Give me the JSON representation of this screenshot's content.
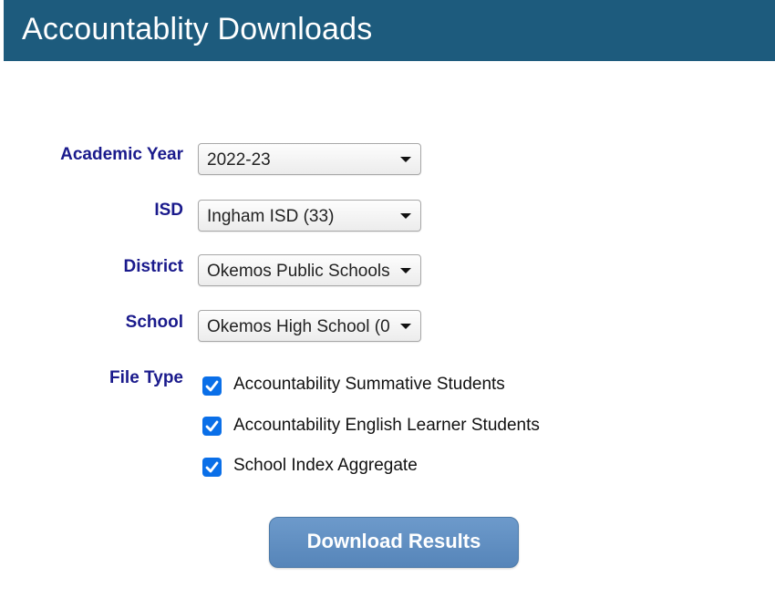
{
  "header": {
    "title": "Accountablity Downloads"
  },
  "form": {
    "academic_year": {
      "label": "Academic Year",
      "value": "2022-23"
    },
    "isd": {
      "label": "ISD",
      "value": "Ingham ISD (33)"
    },
    "district": {
      "label": "District",
      "value": "Okemos Public Schools"
    },
    "school": {
      "label": "School",
      "value": "Okemos High School (0"
    },
    "file_type": {
      "label": "File Type",
      "options": [
        {
          "label": "Accountability Summative Students",
          "checked": true
        },
        {
          "label": "Accountability English Learner Students",
          "checked": true
        },
        {
          "label": "School Index Aggregate",
          "checked": true
        }
      ]
    }
  },
  "download_button": {
    "label": "Download Results"
  },
  "colors": {
    "header_bg": "#1d5b7d",
    "label_text": "#1a1a8c",
    "checkbox_accent": "#0a6fe8",
    "button_bg": "#5f8fc2"
  },
  "icons": {
    "select_arrow": "chevron-down-icon",
    "checkbox": "checkmark-icon"
  }
}
